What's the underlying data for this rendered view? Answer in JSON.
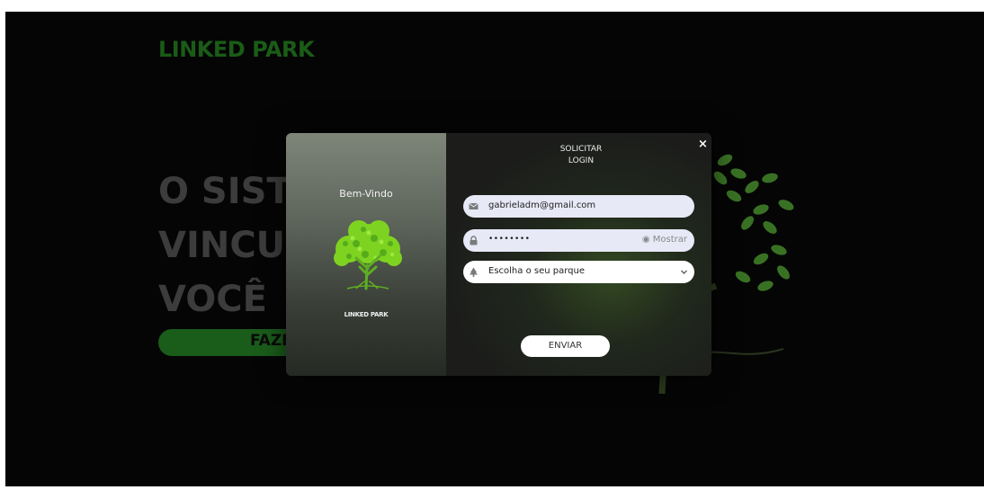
{
  "brand": "LINKED PARK",
  "hero": {
    "lines": [
      "O SISTEMA",
      "VINCULADO",
      "VOCÊ"
    ],
    "cta_label": "FAZER"
  },
  "modal": {
    "welcome": "Bem-Vindo",
    "logo_text": "LINKED PARK",
    "title_line1": "SOLICITAR",
    "title_line2": "LOGIN",
    "close_label": "×",
    "email_value": "gabrieladm@gmail.com",
    "password_value": "••••••••",
    "show_label": "Mostrar",
    "park_placeholder": "Escolha o seu parque",
    "submit_label": "ENVIAR",
    "icons": {
      "email": "envelope-icon",
      "password": "lock-icon",
      "show": "eye-icon",
      "park": "tree-icon",
      "dropdown": "chevron-down-icon",
      "close": "close-icon"
    }
  },
  "colors": {
    "brand": "#1a5c17",
    "page_bg": "#050505",
    "cta_bg": "#1a5c1a",
    "field_bg": "#e8e9f7",
    "tree_green": "#7ed321"
  }
}
